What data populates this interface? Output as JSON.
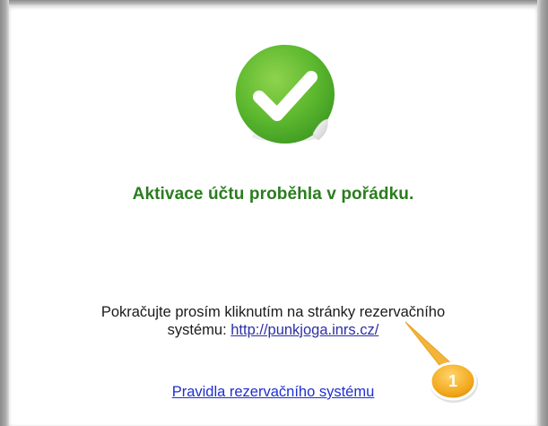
{
  "activation": {
    "title": "Aktivace účtu proběhla v pořádku.",
    "message_line1": "Pokračujte prosím kliknutím na stránky rezervačního",
    "message_line2_prefix": "systému: ",
    "site_link": "http://punkjoga.inrs.cz/",
    "rules_link": "Pravidla rezervačního systému"
  },
  "callout": {
    "number": "1",
    "color": "#f2a81d"
  },
  "colors": {
    "title_green": "#2a7d1e",
    "icon_green": "#5cb82e",
    "link_blue": "#1f2fd0"
  },
  "icons": {
    "success": "checkmark-sticker-icon"
  }
}
